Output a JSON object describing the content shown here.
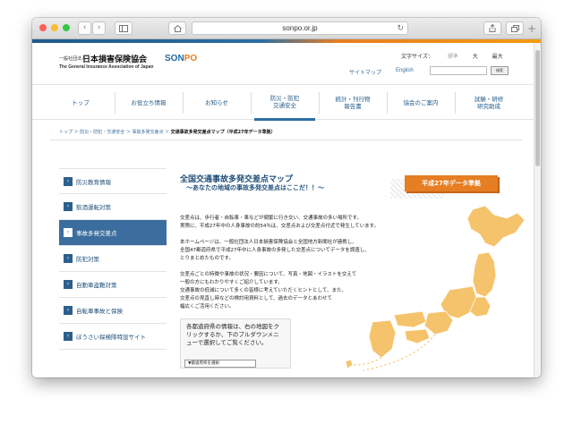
{
  "browser": {
    "url": "sonpo.or.jp",
    "back_icon": "chevron-left-icon",
    "forward_icon": "chevron-right-icon"
  },
  "header": {
    "logo_small": "一般社団法人",
    "logo_main": "日本損害保険協会",
    "logo_en": "The General Insurance Association of Japan",
    "brand_a": "SON",
    "brand_b": "PO",
    "font_size_label": "文字サイズ：",
    "font_sizes": [
      "標準",
      "大",
      "最大"
    ],
    "sitemap": "サイトマップ",
    "english": "English",
    "search_button": "検索"
  },
  "gnav": [
    "トップ",
    "お役立ち情報",
    "お知らせ",
    "防災・防犯\n交通安全",
    "統計・刊行物\n報告書",
    "協会のご案内",
    "試験・研修\n研究助成"
  ],
  "breadcrumb": {
    "items": [
      "トップ",
      "防災・防犯・交通安全",
      "事故多発交差点"
    ],
    "sep": "＞",
    "current": "交通事故多発交差点マップ（平成27年データ準拠）"
  },
  "sidebar": [
    "防災教育情報",
    "飲酒運転対策",
    "事故多発交差点",
    "防犯対策",
    "自動車盗難対策",
    "自転車事故と保険",
    "ぼうさい探検隊特設サイト"
  ],
  "main": {
    "title": "全国交通事故多発交差点マップ",
    "subtitle": "～あなたの地域の事故多発交差点はここだ！！～",
    "badge": "平成27年データ準拠",
    "paragraphs": [
      "交差点は、歩行者・自転車・車などが頻繁に行き交い、交通事故の多い場所です。\n実際に、平成27年中の人身事故の約54％は、交差点および交差点付近で発生しています。",
      "本ホームページは、一般社団法人日本損害保険協会と全国地方新聞社が連携し、\n全国47都道府県で平成27年中に人身事故の多発した交差点についてデータを調査し、\nとりまとめたものです。",
      "交差点ごとの特徴や事故の状況・要因について、写真・地図・イラストを交えて\n一般の方にもわかりやすくご紹介しています。\n交通事故の低減について多くの皆様に考えていただくヒントとして、また、\n交差点の見直し時などの検討用資料として、過去のデータとあわせて\n幅広くご活用ください。"
    ],
    "select_text": "各都道府県の情報は、右の地図をクリックするか、下のプルダウンメニューで選択してご覧ください。",
    "dropdown": "▼都道府県を選択"
  }
}
